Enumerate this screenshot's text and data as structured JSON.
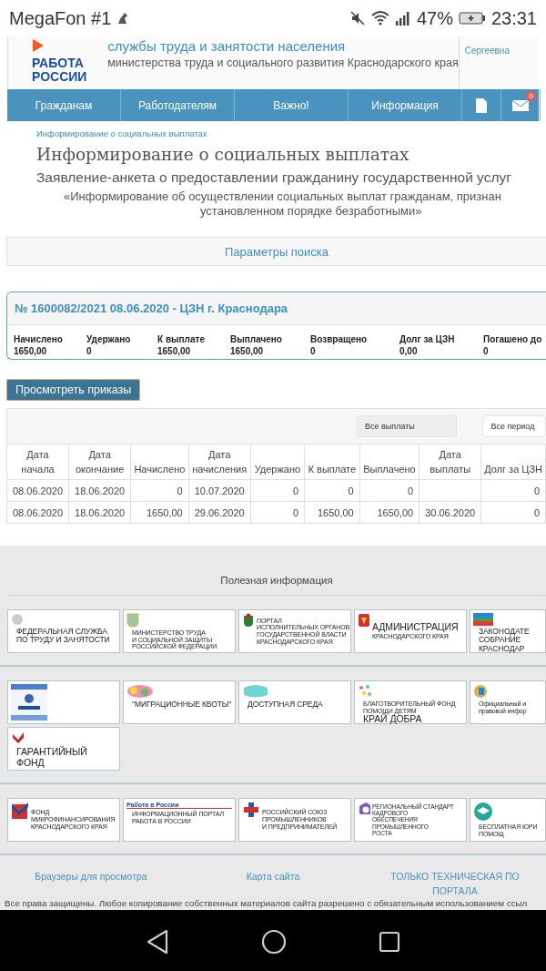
{
  "status_bar": {
    "carrier": "MegaFon #1",
    "battery": "47%",
    "time": "23:31"
  },
  "header": {
    "logo_lines": [
      "РАБОТА",
      "РОССИИ"
    ],
    "title": "службы труда и занятости населения",
    "subtitle": "министерства труда и социального развития Краснодарского края",
    "user": "Сергеевна"
  },
  "nav": {
    "items": [
      {
        "label": "Гражданам"
      },
      {
        "label": "Работодателям"
      },
      {
        "label": "Важно!"
      },
      {
        "label": "Информация"
      }
    ],
    "mail_count": "0"
  },
  "breadcrumb": "Информирование о социальных выплатах",
  "page_title": "Информирование о социальных выплатах",
  "subtitle": "Заявление-анкета о предоставлении гражданину государственной услуг",
  "quote_lines": [
    "«Информирование об осуществлении социальных выплат гражданам, признан",
    "установленном порядке безработными»"
  ],
  "search_panel": "Параметры поиска",
  "case": {
    "title": "№ 1600082/2021 08.06.2020 - ЦЗН г. Краснодара",
    "summary": [
      {
        "label": "Начислено",
        "value": "1650,00"
      },
      {
        "label": "Удержано",
        "value": "0"
      },
      {
        "label": "К выплате",
        "value": "1650,00"
      },
      {
        "label": "Выплачено",
        "value": "1650,00"
      },
      {
        "label": "Возвращено",
        "value": "0"
      },
      {
        "label": "Долг за ЦЗН",
        "value": "0,00"
      },
      {
        "label": "Погашено до",
        "value": "0"
      }
    ]
  },
  "orders_button": "Просмотреть приказы",
  "filters": [
    {
      "value": "Все выплаты",
      "kind": "shaded"
    },
    {
      "value": "Все период",
      "kind": "plain"
    }
  ],
  "table": {
    "columns": [
      {
        "label": "Дата начала",
        "kind": "date"
      },
      {
        "label": "Дата окончание",
        "kind": "date"
      },
      {
        "label": "Начислено",
        "kind": "amount"
      },
      {
        "label": "Дата начисления",
        "kind": "date"
      },
      {
        "label": "Удержано",
        "kind": "amount"
      },
      {
        "label": "К выплате",
        "kind": "amount"
      },
      {
        "label": "Выплачено",
        "kind": "amount"
      },
      {
        "label": "Дата выплаты",
        "kind": "date"
      },
      {
        "label": "Долг за ЦЗН",
        "kind": "amount"
      }
    ],
    "rows": [
      [
        "08.06.2020",
        "18.06.2020",
        "0",
        "10.07.2020",
        "0",
        "0",
        "0",
        null,
        "0"
      ],
      [
        "08.06.2020",
        "18.06.2020",
        "1650,00",
        "29.06.2020",
        "0",
        "1650,00",
        "1650,00",
        "30.06.2020",
        "0"
      ]
    ]
  },
  "footer": {
    "heading": "Полезная информация",
    "banner_groups": [
      [
        {
          "kind": "eagle",
          "lines": [
            "ФЕДЕРАЛЬНАЯ СЛУЖБА",
            "ПО ТРУДУ И ЗАНЯТОСТИ"
          ]
        },
        {
          "kind": "shield",
          "lines": [
            "МИНИСТЕРСТВО ТРУДА",
            "И СОЦИАЛЬНОЙ ЗАЩИТЫ",
            "РОССИЙСКОЙ ФЕДЕРАЦИИ"
          ]
        },
        {
          "kind": "crest",
          "lines": [
            "ПОРТАЛ",
            "ИСПОЛНИТЕЛЬНЫХ ОРГАНОВ",
            "ГОСУДАРСТВЕННОЙ ВЛАСТИ",
            "КРАСНОДАРСКОГО КРАЯ"
          ]
        },
        {
          "kind": "coat",
          "lines": [
            "АДМИНИСТРАЦИЯ",
            "КРАСНОДАРСКОГО КРАЯ"
          ]
        },
        {
          "kind": "flag",
          "lines": [
            "ЗАКОНОДАТЕ",
            "СОБРАНИЕ",
            "КРАСНОДАР"
          ]
        }
      ],
      [
        {
          "kind": "projects"
        },
        {
          "kind": "collage",
          "lines": [
            "\"МИГРАЦИОННЫЕ КВОТЫ\""
          ]
        },
        {
          "kind": "blob",
          "lines": [
            "ДОСТУПНАЯ СРЕДА"
          ]
        },
        {
          "kind": "confetti",
          "lines": [
            "БЛАГОТВОРИТЕЛЬНЫЙ ФОНД ПОМОЩИ ДЕТЯМ",
            "КРАЙ ДОБРА"
          ]
        },
        {
          "kind": "tricolor",
          "lines": [
            "Официальный и",
            "правовой инфор"
          ]
        },
        {
          "kind": "guarantee",
          "lines": [
            "ГАРАНТИЙНЫЙ",
            "ФОНД"
          ]
        }
      ],
      [
        {
          "kind": "check",
          "lines": [
            "ФОНД",
            "МИКРОФИНАНСИРОВАНИЯ",
            "КРАСНОДАРСКОГО КРАЯ"
          ]
        },
        {
          "kind": "brand",
          "brand": "Работа в России",
          "lines": [
            "ИНФОРМАЦИОННЫЙ ПОРТАЛ",
            "РАБОТА В РОССИИ"
          ]
        },
        {
          "kind": "cross",
          "lines": [
            "РОССИЙСКИЙ СОЮЗ",
            "ПРОМЫШЛЕННИКОВ",
            "И ПРЕДПРИНИМАТЕЛЕЙ"
          ]
        },
        {
          "kind": "hexagon",
          "lines": [
            "РЕГИОНАЛЬНЫЙ СТАНДАРТ КАДРОВОГО",
            "ОБЕСПЕЧЕНИЯ ПРОМЫШЛЕННОГО",
            "РОСТА"
          ]
        },
        {
          "kind": "cap",
          "lines": [
            "БЕСПЛАТНАЯ ЮРИ",
            "ПОМОЩ"
          ]
        }
      ]
    ],
    "links": [
      {
        "lines": [
          "Браузеры для просмотра"
        ]
      },
      {
        "lines": [
          "Карта сайта"
        ]
      },
      {
        "lines": [
          "ТОЛЬКО ТЕХНИЧЕСКАЯ ПО",
          "ПОРТАЛА"
        ]
      }
    ],
    "copyright": "Все права защищены. Любое копирование собственных материалов сайта разрешено с обязательным использованием ссыл"
  }
}
